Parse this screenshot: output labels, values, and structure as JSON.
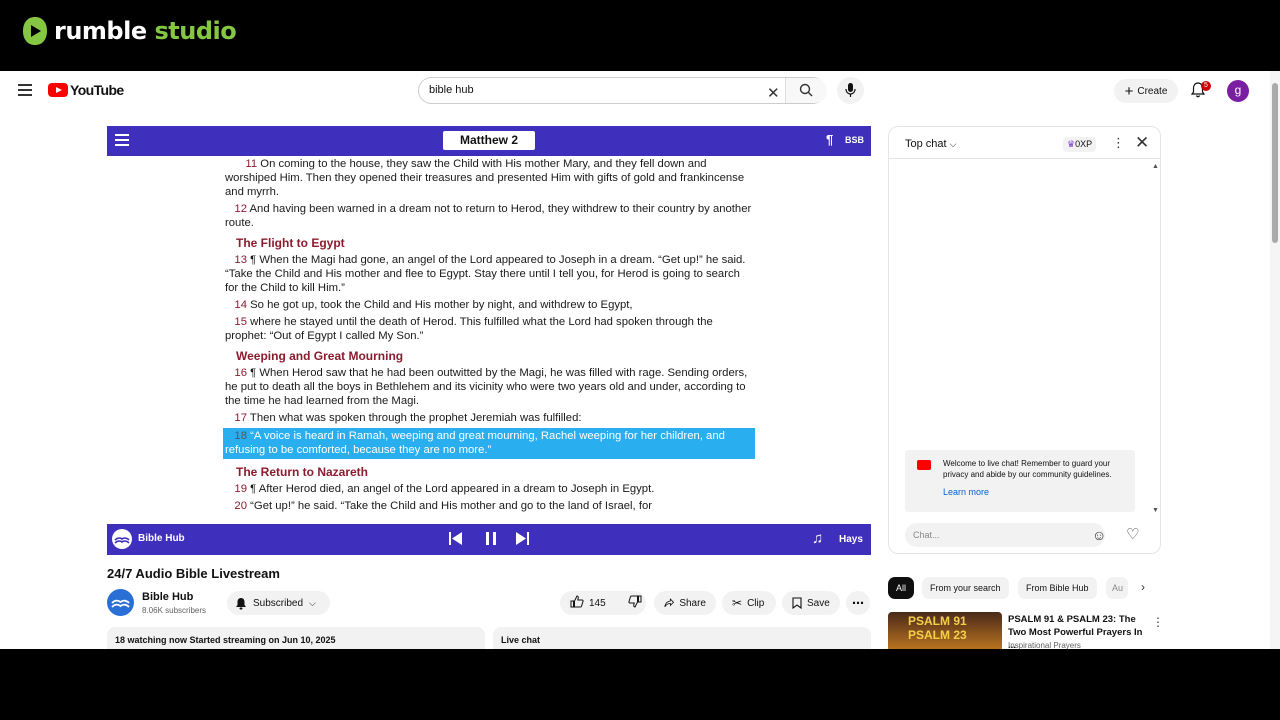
{
  "rumble": {
    "brand": "rumble",
    "studio": "studio"
  },
  "youtube": {
    "logo_text": "YouTube",
    "search_value": "bible hub",
    "create_label": "Create",
    "notification_count": "5",
    "avatar_letter": "g"
  },
  "player": {
    "chapter": "Matthew 2",
    "pilcrow": "¶",
    "version": "BSB",
    "bottom_name": "Bible Hub",
    "narrator": "Hays",
    "verses": {
      "v11_num": "11",
      "v11": " On coming to the house, they saw the Child with His mother Mary, and they fell down and worshiped Him. Then they opened their treasures and presented Him with gifts of gold and frankincense and myrrh.",
      "v12_num": "12",
      "v12": " And having been warned in a dream not to return to Herod, they withdrew to their country by another route.",
      "h1": "The Flight to Egypt",
      "v13_num": "13",
      "v13": " ¶ When the Magi had gone, an angel of the Lord appeared to Joseph in a dream. “Get up!” he said. “Take the Child and His mother and flee to Egypt. Stay there until I tell you, for Herod is going to search for the Child to kill Him.”",
      "v14_num": "14",
      "v14": " So he got up, took the Child and His mother by night, and withdrew to Egypt,",
      "v15_num": "15",
      "v15": " where he stayed until the death of Herod. This fulfilled what the Lord had spoken through the prophet: “Out of Egypt I called My Son.”",
      "h2": "Weeping and Great Mourning",
      "v16_num": "16",
      "v16": " ¶ When Herod saw that he had been outwitted by the Magi, he was filled with rage. Sending orders, he put to death all the boys in Bethlehem and its vicinity who were two years old and under, according to the time he had learned from the Magi.",
      "v17_num": "17",
      "v17": " Then what was spoken through the prophet Jeremiah was fulfilled:",
      "v18_num": "18",
      "v18": " “A voice is heard in Ramah, weeping and great mourning, Rachel weeping for her children, and refusing to be comforted, because they are no more.”",
      "h3": "The Return to Nazareth",
      "v19_num": "19",
      "v19": " ¶ After Herod died, an angel of the Lord appeared in a dream to Joseph in Egypt.",
      "v20_num": "20",
      "v20": " “Get up!” he said. “Take the Child and His mother and go to the land of Israel, for"
    }
  },
  "video": {
    "title": "24/7 Audio Bible Livestream",
    "channel": "Bible Hub",
    "subscribers": "8.06K subscribers",
    "subscribed_label": "Subscribed",
    "likes": "145",
    "share": "Share",
    "clip": "Clip",
    "save": "Save",
    "watching": "18 watching now  Started streaming on Jun 10, 2025",
    "live_chat_label": "Live chat"
  },
  "chat": {
    "mode": "Top chat",
    "xp": "0XP",
    "welcome": "Welcome to live chat! Remember to guard your privacy and abide by our community guidelines.",
    "learn_more": "Learn more",
    "placeholder": "Chat..."
  },
  "recommendations": {
    "chips": [
      "All",
      "From your search",
      "From Bible Hub",
      "Au"
    ],
    "item": {
      "thumb_line1": "PSALM 91",
      "thumb_line2": "PSALM 23",
      "title": "PSALM 91 & PSALM 23: The Two Most Powerful Prayers In ...",
      "channel": "Inspirational Prayers"
    }
  },
  "colors": {
    "bible_hub_purple": "#3f2fbd",
    "highlight": "#29aef0",
    "verse_red": "#8a1c2e",
    "rumble_green": "#85c742"
  }
}
